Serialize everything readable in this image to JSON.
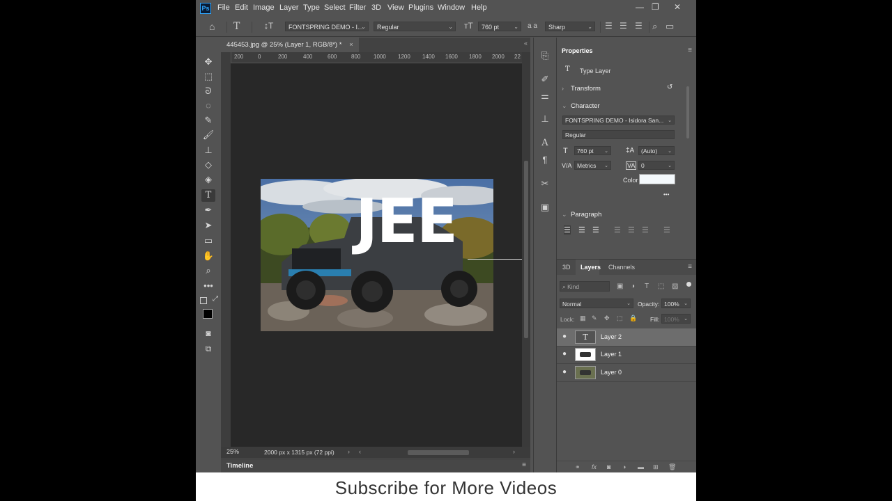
{
  "app": {
    "logo": "Ps",
    "min_icon": "—",
    "max_icon": "❐",
    "close_icon": "✕"
  },
  "menu": [
    "File",
    "Edit",
    "Image",
    "Layer",
    "Type",
    "Select",
    "Filter",
    "3D",
    "View",
    "Plugins",
    "Window",
    "Help"
  ],
  "options": {
    "font_family": "FONTSPRING DEMO - I...",
    "font_style": "Regular",
    "font_size": "760 pt",
    "aa_label": "a a",
    "antialias": "Sharp"
  },
  "document": {
    "tab_title": "445453.jpg @ 25% (Layer 1, RGB/8*) *",
    "tab_close": "×",
    "ruler_ticks": [
      "200",
      "0",
      "200",
      "400",
      "600",
      "800",
      "1000",
      "1200",
      "1400",
      "1600",
      "1800",
      "2000",
      "22"
    ],
    "zoom": "25%",
    "doc_info": "2000 px x 1315 px (72 ppi)",
    "canvas_text": "JEE"
  },
  "timeline": {
    "label": "Timeline"
  },
  "properties": {
    "tab": "Properties",
    "type": "Type Layer",
    "transform": "Transform",
    "character": "Character",
    "font_family": "FONTSPRING DEMO - Isidora San...",
    "font_style": "Regular",
    "font_size": "760 pt",
    "leading": "(Auto)",
    "kerning": "Metrics",
    "tracking": "0",
    "color_label": "Color",
    "more": "•••",
    "paragraph": "Paragraph"
  },
  "layers_panel": {
    "tabs": [
      "3D",
      "Layers",
      "Channels"
    ],
    "kind_placeholder": "Kind",
    "blend": "Normal",
    "opacity_label": "Opacity:",
    "opacity": "100%",
    "lock_label": "Lock:",
    "fill_label": "Fill:",
    "fill": "100%",
    "layers": [
      {
        "name": "Layer 2"
      },
      {
        "name": "Layer 1"
      },
      {
        "name": "Layer 0"
      }
    ]
  },
  "footer": {
    "text": "Subscribe for More Videos"
  },
  "colors": {
    "ui_bg": "#535353",
    "canvas_bg": "#282828",
    "accent": "#31a8ff",
    "text_color": "#ffffff"
  }
}
